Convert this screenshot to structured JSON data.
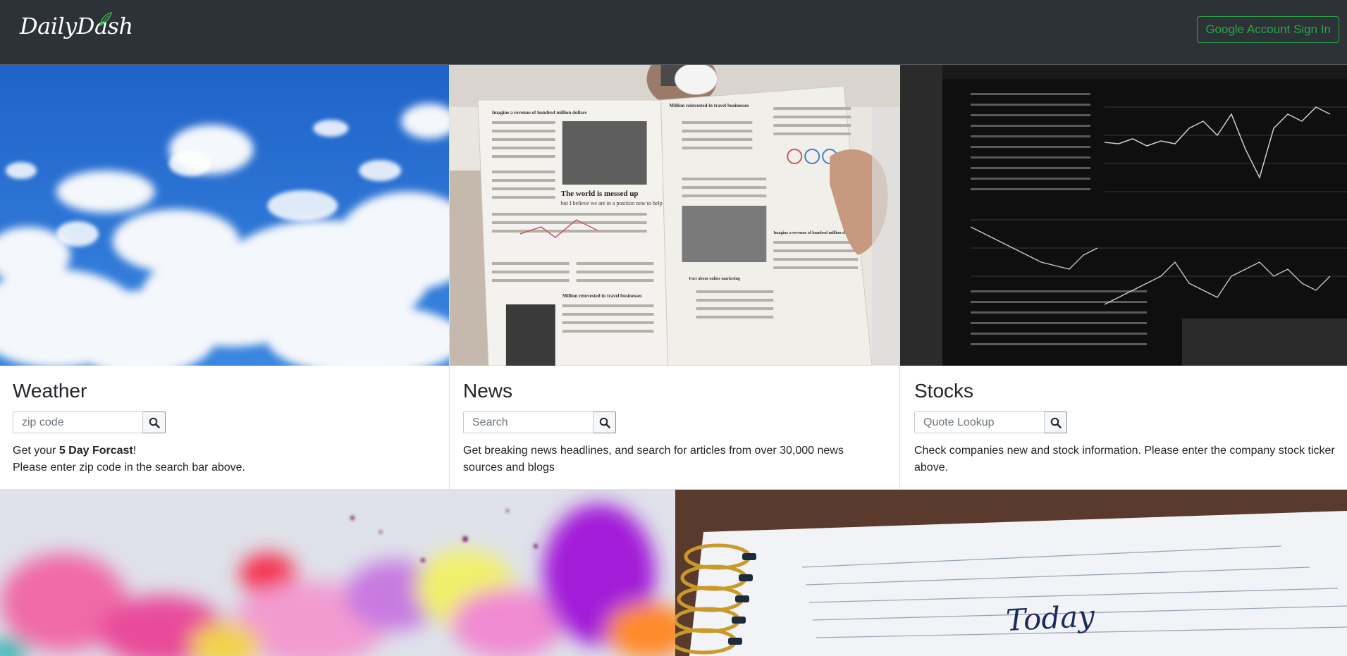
{
  "navbar": {
    "brand": "DailyDash",
    "signin_label": "Google Account Sign In"
  },
  "cards": {
    "weather": {
      "title": "Weather",
      "placeholder": "zip code",
      "text_prefix": "Get your ",
      "text_bold": "5 Day Forcast",
      "text_suffix": "!",
      "text_line2": "Please enter zip code in the search bar above."
    },
    "news": {
      "title": "News",
      "placeholder": "Search",
      "text": "Get breaking news headlines, and search for articles from over 30,000 news sources and blogs"
    },
    "stocks": {
      "title": "Stocks",
      "placeholder": "Quote Lookup",
      "text": "Check companies new and stock information. Please enter the company stock ticker above."
    }
  },
  "newspaper_headlines": {
    "main": "The world is messed up",
    "sub": "but I believe we are in a position now to help",
    "top_left": "Imagine a revenue of hundred million dollars",
    "top_right": "Million reinvested in travel businesses",
    "mid_right": "Imagine a revenue of hundred million dollars",
    "bottom_center": "Fact about online marketing",
    "bottom_left": "Million reinvested in travel businesses"
  },
  "notebook_text": "Today",
  "colors": {
    "navbar_bg": "#2d3238",
    "accent_green": "#28a745"
  },
  "icons": {
    "search": "search-icon",
    "brand_leaf": "leaf-icon"
  }
}
